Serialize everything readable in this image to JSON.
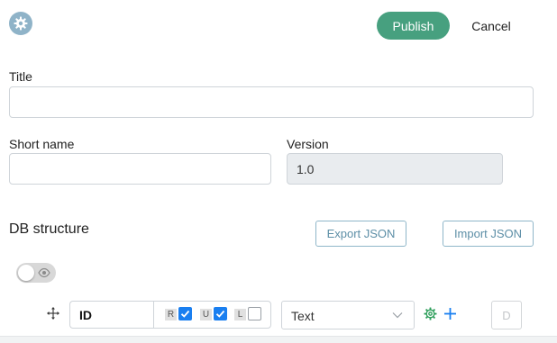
{
  "header": {
    "settings_icon": "gear-icon",
    "publish_label": "Publish",
    "cancel_label": "Cancel"
  },
  "form": {
    "title_label": "Title",
    "title_value": "",
    "short_name_label": "Short name",
    "short_name_value": "",
    "version_label": "Version",
    "version_value": "1.0"
  },
  "db_structure": {
    "heading": "DB structure",
    "export_label": "Export JSON",
    "import_label": "Import JSON",
    "preview_toggle": {
      "on": false,
      "icon": "eye-icon"
    },
    "fields": [
      {
        "name": "ID",
        "flags": [
          {
            "letter": "R",
            "checked": true
          },
          {
            "letter": "U",
            "checked": true
          },
          {
            "letter": "L",
            "checked": false
          }
        ],
        "type": "Text",
        "delete_label": "D"
      }
    ]
  },
  "colors": {
    "primary": "#47a07f",
    "outline": "#8fb6c9",
    "gear_bg": "#8fb3c8",
    "checkbox": "#1a7ff0",
    "settings_green": "#2e9e5b",
    "add_blue": "#1a7ff0"
  }
}
